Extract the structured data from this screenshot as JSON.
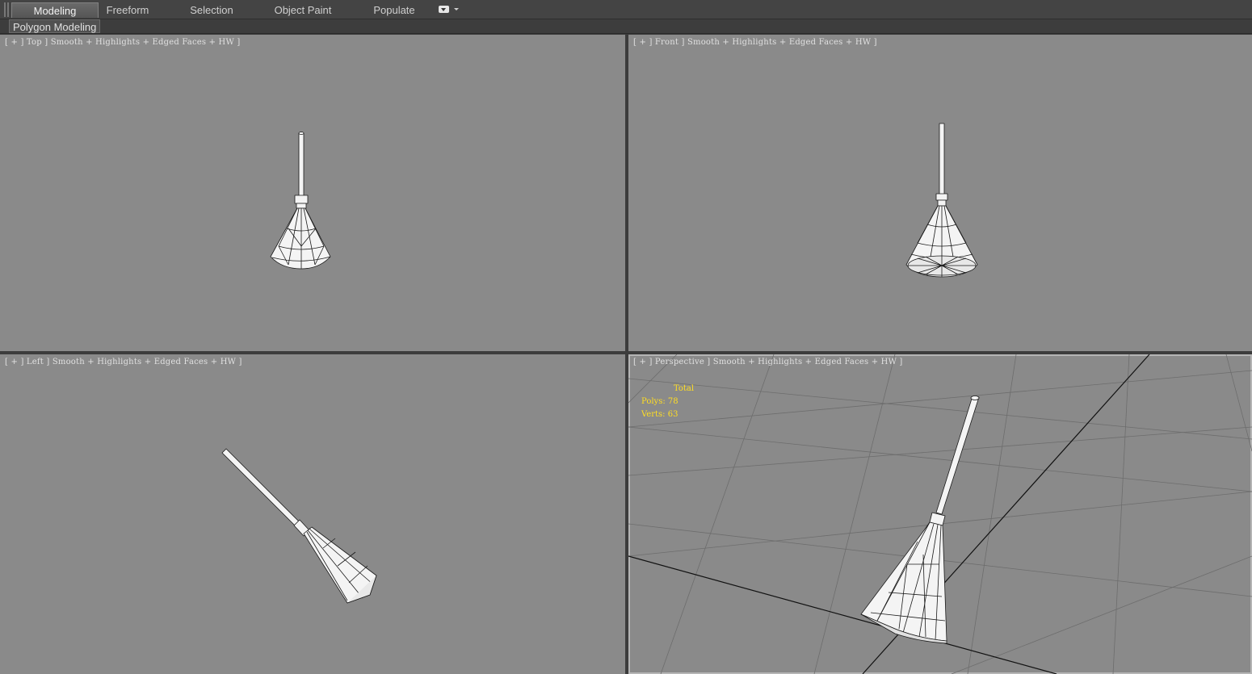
{
  "ribbon": {
    "tabs": [
      {
        "label": "Modeling",
        "active": true
      },
      {
        "label": "Freeform",
        "active": false
      },
      {
        "label": "Selection",
        "active": false
      },
      {
        "label": "Object Paint",
        "active": false
      },
      {
        "label": "Populate",
        "active": false
      }
    ],
    "panel_label": "Polygon Modeling"
  },
  "viewports": {
    "top": {
      "label": "[ + ] Top ] Smooth + Highlights + Edged Faces + HW ]"
    },
    "front": {
      "label": "[ + ] Front ] Smooth + Highlights + Edged Faces + HW ]"
    },
    "left": {
      "label": "[ + ] Left ] Smooth + Highlights + Edged Faces + HW ]"
    },
    "perspective": {
      "label": "[ + ] Perspective ] Smooth + Highlights + Edged Faces + HW ]",
      "stats": {
        "title": "Total",
        "polys": "Polys: 78",
        "verts": "Verts: 63"
      }
    }
  },
  "colors": {
    "viewport_bg": "#8a8a8a",
    "stats_text": "#ffdd22",
    "label_text": "#e0e0e0",
    "mesh_fill": "#f4f4f4",
    "mesh_edge": "#1a1a1a"
  }
}
